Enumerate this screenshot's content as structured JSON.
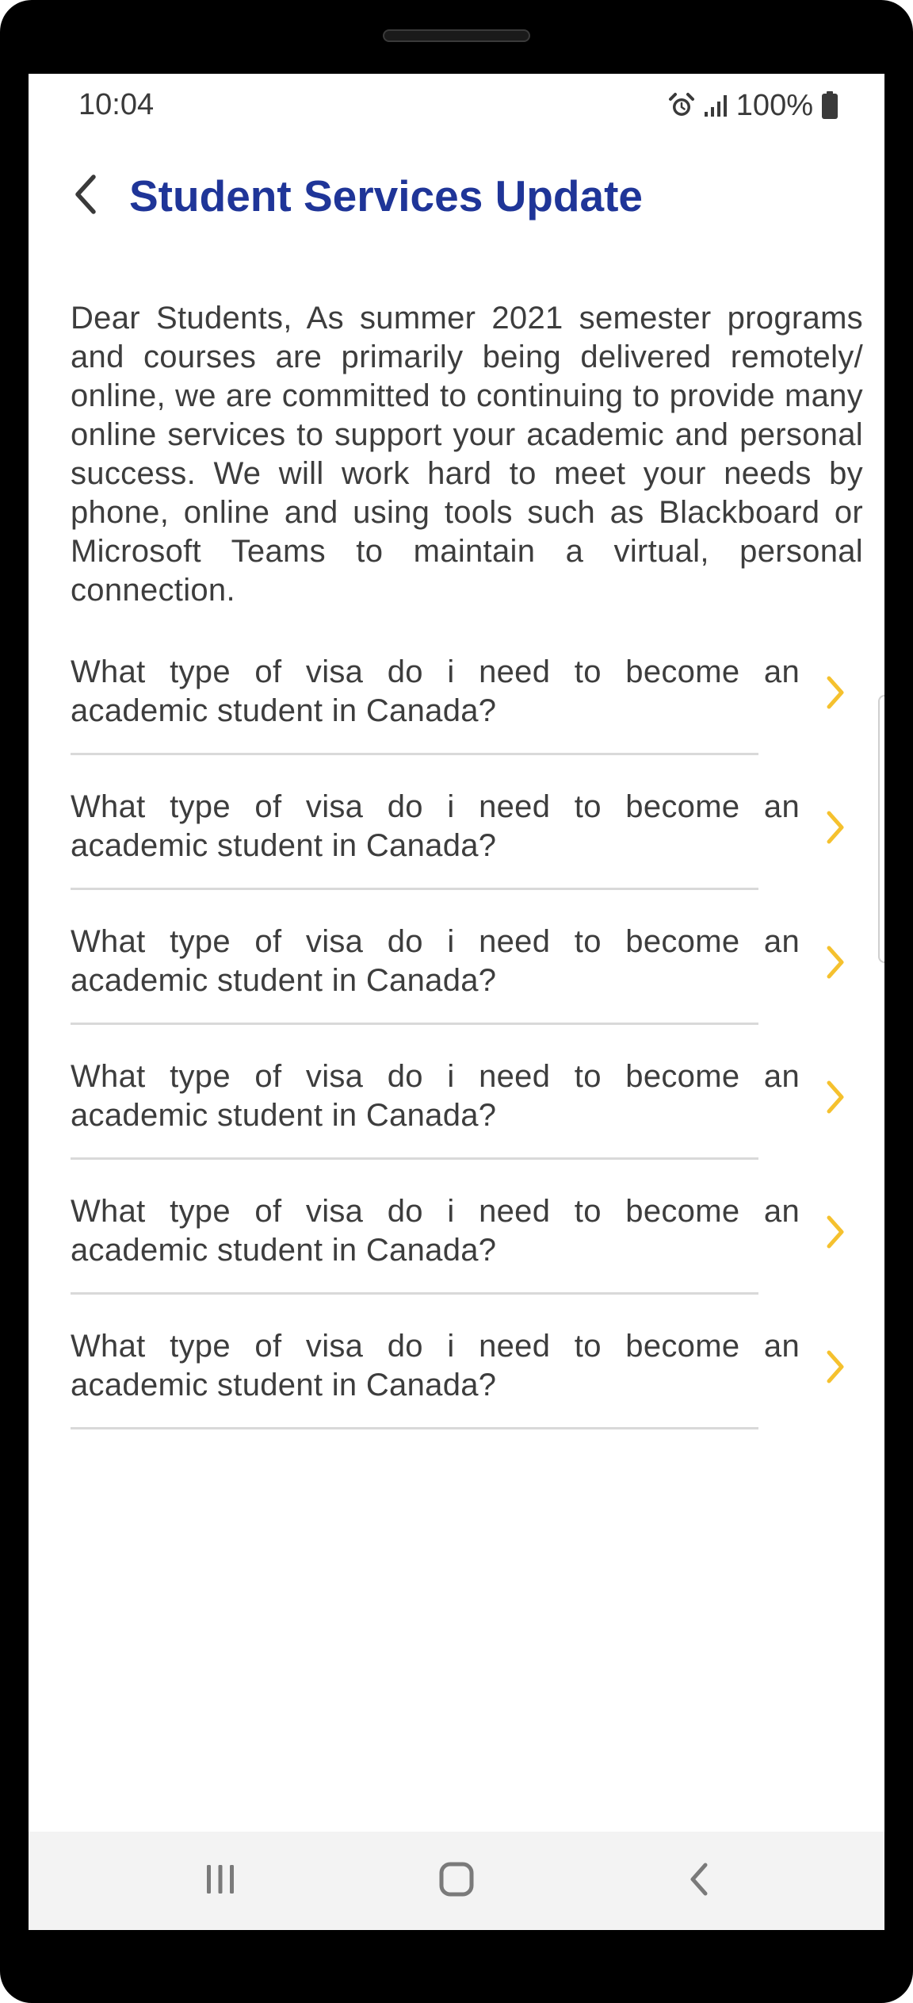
{
  "status_bar": {
    "time": "10:04",
    "battery": "100%",
    "icons": [
      "alarm-icon",
      "signal-icon",
      "battery-icon"
    ]
  },
  "header": {
    "title": "Student Services Update",
    "back_icon": "chevron-left-icon"
  },
  "intro": {
    "text": "Dear Students, As summer 2021 semester programs and courses are primarily being delivered remotely/ online, we are committed to continuing to provide many online services to support your academic and personal success. We will work hard to meet your needs by phone, online and using tools such as Blackboard or Microsoft Teams to maintain a virtual, personal connection."
  },
  "faq": {
    "items": [
      {
        "question": "What type of visa do i need to become an academic student in Canada?"
      },
      {
        "question": "What type of visa do i need to become an academic student in Canada?"
      },
      {
        "question": "What type of visa do i need to become an academic student in Canada?"
      },
      {
        "question": "What type of visa do i need to become an academic student in Canada?"
      },
      {
        "question": "What type of visa do i need to become an academic student in Canada?"
      },
      {
        "question": "What type of visa do i need to become an academic student in Canada?"
      }
    ]
  },
  "nav_bar": {
    "buttons": [
      "recent-apps-icon",
      "home-icon",
      "back-icon"
    ]
  },
  "colors": {
    "title": "#1f3598",
    "chevron": "#f5c12e",
    "text": "#3d3d3d",
    "divider": "#d9d9d9"
  }
}
